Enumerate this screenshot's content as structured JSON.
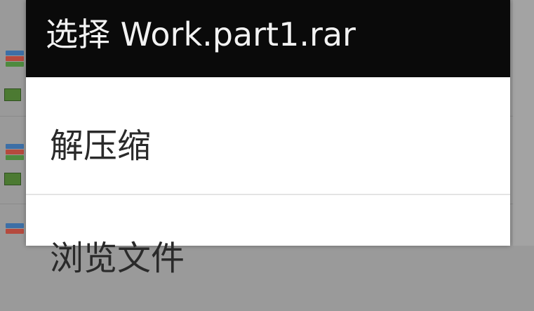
{
  "dialog": {
    "title": "选择 Work.part1.rar",
    "items": [
      {
        "label": "解压缩"
      },
      {
        "label": "浏览文件"
      }
    ]
  },
  "colors": {
    "header_bg": "#0a0a0a",
    "dialog_bg": "#ffffff",
    "scrim": "#9a9a9a"
  }
}
